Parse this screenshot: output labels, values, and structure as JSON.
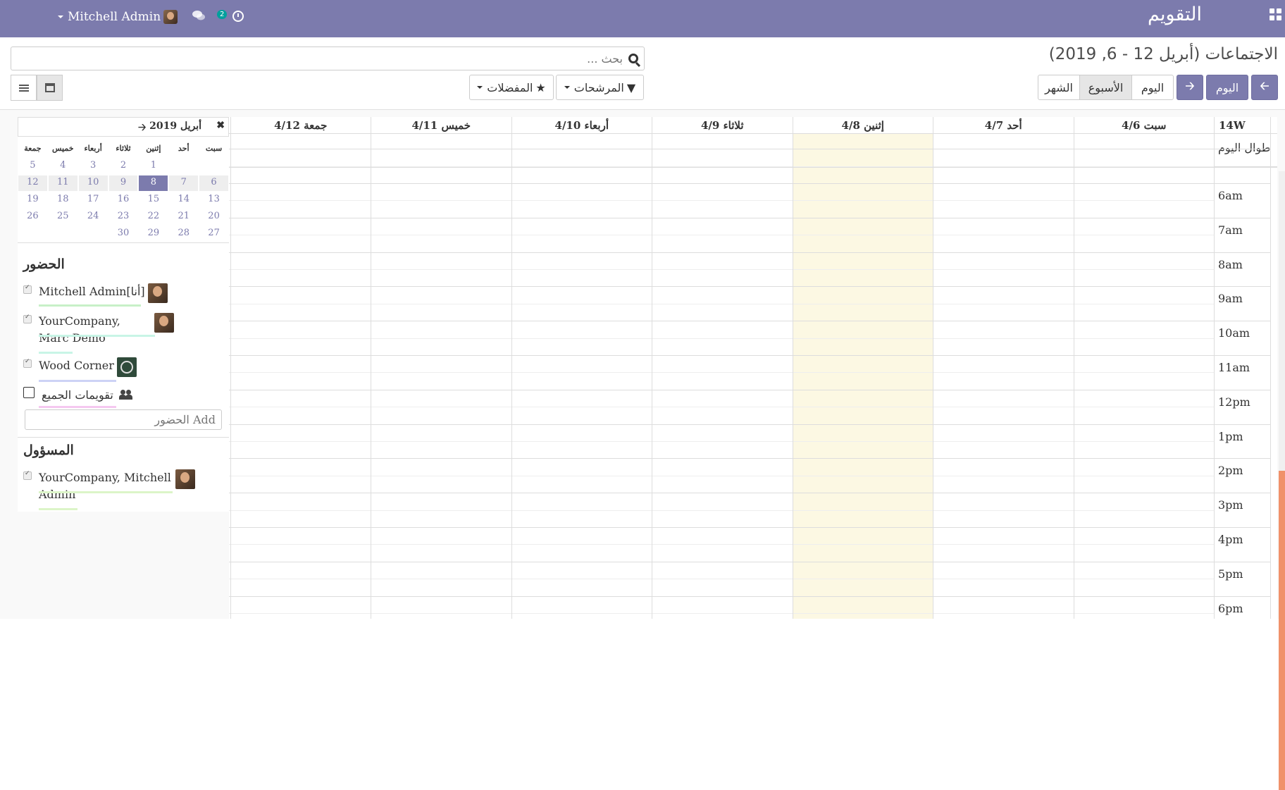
{
  "navbar": {
    "title": "التقويم",
    "user_name": "Mitchell Admin",
    "message_badge": "2"
  },
  "control_panel": {
    "breadcrumb": "الاجتماعات (أبريل 12 - 6, 2019)",
    "search_placeholder": "بحث ...",
    "filters_label": "المرشحات",
    "favorites_label": "المفضلات",
    "today_label": "اليوم",
    "scale_day": "اليوم",
    "scale_week": "الأسبوع",
    "scale_month": "الشهر",
    "active_scale": "week",
    "accent_color": "#7c7bad"
  },
  "mini_calendar": {
    "title": "أبريل 2019",
    "weekdays": [
      "سبت",
      "أحد",
      "إثنين",
      "ثلاثاء",
      "أربعاء",
      "خميس",
      "جمعة"
    ],
    "weeks": [
      [
        "",
        "",
        "1",
        "2",
        "3",
        "4",
        "5"
      ],
      [
        "6",
        "7",
        "8",
        "9",
        "10",
        "11",
        "12"
      ],
      [
        "13",
        "14",
        "15",
        "16",
        "17",
        "18",
        "19"
      ],
      [
        "20",
        "21",
        "22",
        "23",
        "24",
        "25",
        "26"
      ],
      [
        "27",
        "28",
        "29",
        "30",
        "",
        "",
        ""
      ]
    ],
    "today": "8"
  },
  "attendees": {
    "title": "الحضور",
    "items": [
      {
        "label": "Mitchell Admin[أنا]",
        "checked": true,
        "line_color": "#c8f0c8"
      },
      {
        "label": "YourCompany, Marc Demo",
        "checked": true,
        "line_color": "#c8f5e6"
      },
      {
        "label": "Wood Corner",
        "checked": true,
        "line_color": "#cdd2f5"
      },
      {
        "label": "تقويمات الجميع",
        "checked": false,
        "line_color": "#f5c8f0"
      }
    ],
    "add_placeholder": "Add الحضور"
  },
  "responsible": {
    "title": "المسؤول",
    "items": [
      {
        "label": "YourCompany, Mitchell Admin",
        "checked": true,
        "line_color": "#dcf5c8"
      }
    ]
  },
  "calendar": {
    "week_label": "14W",
    "allday_label": "طوال اليوم",
    "days": [
      "سبت 4/6",
      "أحد 4/7",
      "إثنين 4/8",
      "ثلاثاء 4/9",
      "أربعاء 4/10",
      "خميس 4/11",
      "جمعة 4/12"
    ],
    "today_index": 2,
    "hours": [
      "6am",
      "7am",
      "8am",
      "9am",
      "10am",
      "11am",
      "12pm",
      "1pm",
      "2pm",
      "3pm",
      "4pm",
      "5pm",
      "6pm"
    ],
    "today_color": "#fcf8e3"
  }
}
